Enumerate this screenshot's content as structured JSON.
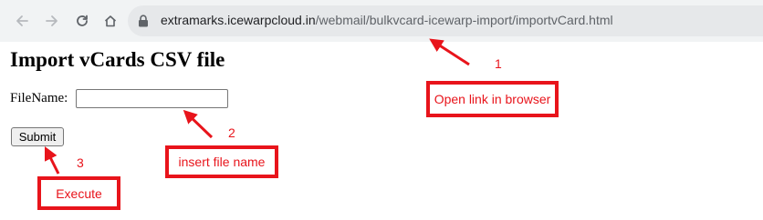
{
  "browser": {
    "back_icon": "arrow-left-icon",
    "forward_icon": "arrow-right-icon",
    "reload_icon": "reload-icon",
    "home_icon": "home-icon",
    "lock_icon": "lock-icon",
    "url_host": "extramarks.icewarpcloud.in",
    "url_path": "/webmail/bulkvcard-icewarp-import/importvCard.html"
  },
  "page": {
    "title": "Import vCards CSV file",
    "filename_label": "FileName:",
    "filename_value": "",
    "submit_label": "Submit"
  },
  "annotations": {
    "color": "#e8141b",
    "steps": [
      {
        "number": "1",
        "text": "Open link in browser"
      },
      {
        "number": "2",
        "text": "insert file name"
      },
      {
        "number": "3",
        "text": "Execute"
      }
    ]
  }
}
